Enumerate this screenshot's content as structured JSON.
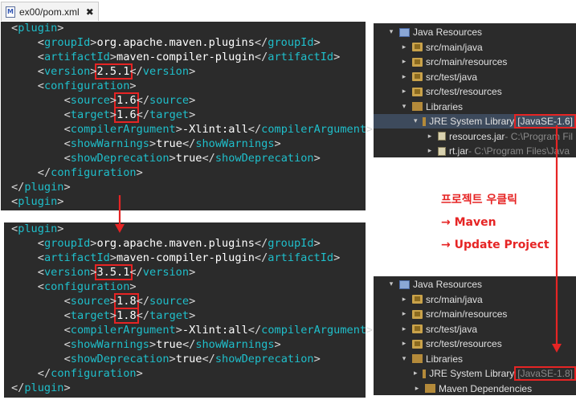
{
  "tab": {
    "title": "ex00/pom.xml",
    "icon": "maven-file-icon"
  },
  "code_before": {
    "lines": [
      {
        "indent": 0,
        "tag": "plugin",
        "kind": "open"
      },
      {
        "indent": 1,
        "tag": "groupId",
        "value": "org.apache.maven.plugins"
      },
      {
        "indent": 1,
        "tag": "artifactId",
        "value": "maven-compiler-plugin"
      },
      {
        "indent": 1,
        "tag": "version",
        "value": "2.5.1",
        "highlight": true
      },
      {
        "indent": 1,
        "tag": "configuration",
        "kind": "open"
      },
      {
        "indent": 2,
        "tag": "source",
        "value": "1.6",
        "highlight": true
      },
      {
        "indent": 2,
        "tag": "target",
        "value": "1.6",
        "highlight": true
      },
      {
        "indent": 2,
        "tag": "compilerArgument",
        "value": "-Xlint:all"
      },
      {
        "indent": 2,
        "tag": "showWarnings",
        "value": "true"
      },
      {
        "indent": 2,
        "tag": "showDeprecation",
        "value": "true"
      },
      {
        "indent": 1,
        "tag": "configuration",
        "kind": "close"
      },
      {
        "indent": 0,
        "tag": "plugin",
        "kind": "close"
      },
      {
        "indent": 0,
        "tag": "plugin",
        "kind": "open"
      }
    ]
  },
  "code_after": {
    "lines": [
      {
        "indent": 0,
        "tag": "plugin",
        "kind": "open"
      },
      {
        "indent": 1,
        "tag": "groupId",
        "value": "org.apache.maven.plugins"
      },
      {
        "indent": 1,
        "tag": "artifactId",
        "value": "maven-compiler-plugin"
      },
      {
        "indent": 1,
        "tag": "version",
        "value": "3.5.1",
        "highlight": true
      },
      {
        "indent": 1,
        "tag": "configuration",
        "kind": "open"
      },
      {
        "indent": 2,
        "tag": "source",
        "value": "1.8",
        "highlight": true
      },
      {
        "indent": 2,
        "tag": "target",
        "value": "1.8",
        "highlight": true
      },
      {
        "indent": 2,
        "tag": "compilerArgument",
        "value": "-Xlint:all"
      },
      {
        "indent": 2,
        "tag": "showWarnings",
        "value": "true"
      },
      {
        "indent": 2,
        "tag": "showDeprecation",
        "value": "true"
      },
      {
        "indent": 1,
        "tag": "configuration",
        "kind": "close"
      },
      {
        "indent": 0,
        "tag": "plugin",
        "kind": "close"
      }
    ]
  },
  "tree_before": {
    "rows": [
      {
        "depth": 0,
        "twisty": "▾",
        "icon": "project-icon",
        "label": "Java Resources"
      },
      {
        "depth": 1,
        "twisty": "▸",
        "icon": "package-folder-icon",
        "label": "src/main/java"
      },
      {
        "depth": 1,
        "twisty": "▸",
        "icon": "package-folder-icon",
        "label": "src/main/resources"
      },
      {
        "depth": 1,
        "twisty": "▸",
        "icon": "package-folder-icon",
        "label": "src/test/java"
      },
      {
        "depth": 1,
        "twisty": "▸",
        "icon": "package-folder-icon",
        "label": "src/test/resources"
      },
      {
        "depth": 1,
        "twisty": "▾",
        "icon": "libraries-icon",
        "label": "Libraries"
      },
      {
        "depth": 2,
        "twisty": "▾",
        "icon": "library-icon",
        "label": "JRE System Library ",
        "suffix": "[JavaSE-1.6]",
        "highlight": true,
        "selected": true
      },
      {
        "depth": 3,
        "twisty": "▸",
        "icon": "jar-icon",
        "label": "resources.jar",
        "suffix": " - C:\\Program Fil"
      },
      {
        "depth": 3,
        "twisty": "▸",
        "icon": "jar-icon",
        "label": "rt.jar",
        "suffix": " - C:\\Program Files\\Java"
      }
    ]
  },
  "tree_after": {
    "rows": [
      {
        "depth": 0,
        "twisty": "▾",
        "icon": "project-icon",
        "label": "Java Resources"
      },
      {
        "depth": 1,
        "twisty": "▸",
        "icon": "package-folder-icon",
        "label": "src/main/java"
      },
      {
        "depth": 1,
        "twisty": "▸",
        "icon": "package-folder-icon",
        "label": "src/main/resources"
      },
      {
        "depth": 1,
        "twisty": "▸",
        "icon": "package-folder-icon",
        "label": "src/test/java"
      },
      {
        "depth": 1,
        "twisty": "▸",
        "icon": "package-folder-icon",
        "label": "src/test/resources"
      },
      {
        "depth": 1,
        "twisty": "▾",
        "icon": "libraries-icon",
        "label": "Libraries"
      },
      {
        "depth": 2,
        "twisty": "▸",
        "icon": "library-icon",
        "label": "JRE System Library ",
        "suffix": "[JavaSE-1.8]",
        "highlight": true
      },
      {
        "depth": 2,
        "twisty": "▸",
        "icon": "library-icon",
        "label": "Maven Dependencies"
      }
    ]
  },
  "annotation": {
    "line1": "프로젝트 우클릭",
    "line2": "→ Maven",
    "line3": "→ Update Project"
  },
  "colors": {
    "highlight": "#e62424",
    "editor_bg": "#2b2b2b",
    "xml_tag": "#1fbfcb"
  }
}
